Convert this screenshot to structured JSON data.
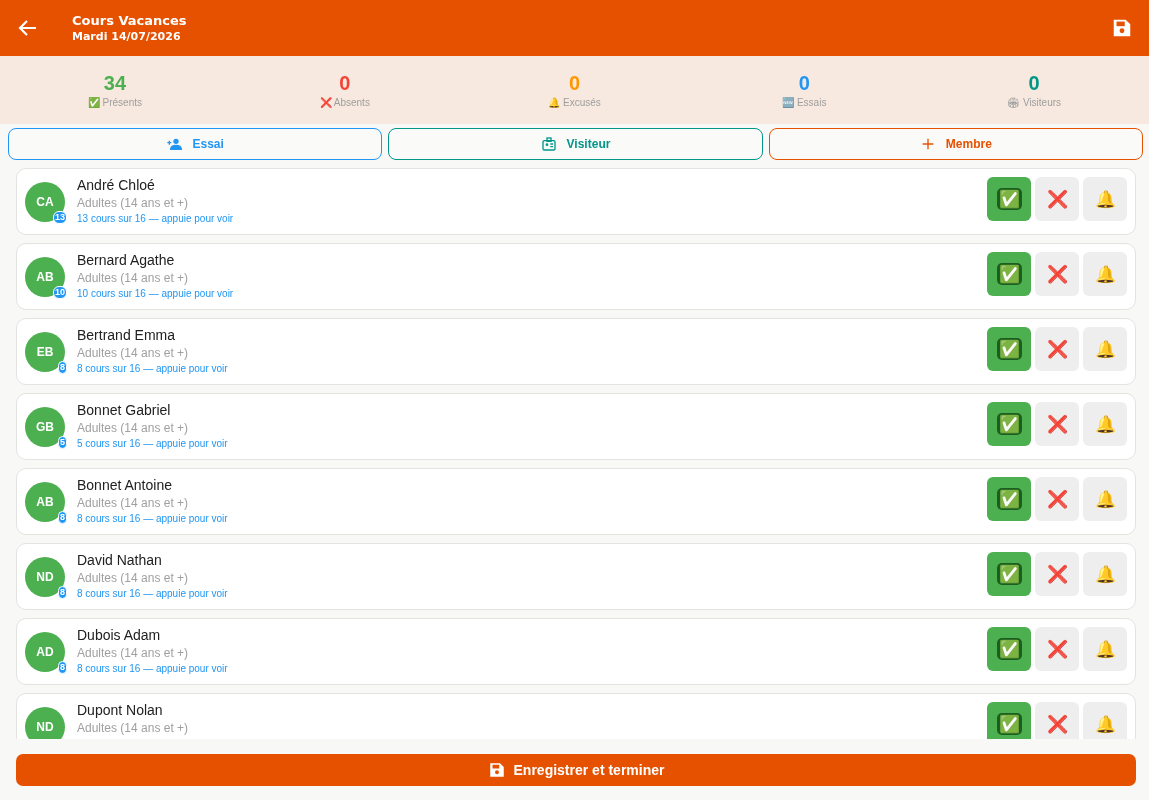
{
  "header": {
    "title": "Cours Vacances",
    "subtitle": "Mardi 14/07/2026"
  },
  "stats": [
    {
      "value": "34",
      "label": "✅ Présents",
      "color": "#4caf50"
    },
    {
      "value": "0",
      "label": "❌ Absents",
      "color": "#f44336"
    },
    {
      "value": "0",
      "label": "🔔 Excusés",
      "color": "#ff9800"
    },
    {
      "value": "0",
      "label": "🆕 Essais",
      "color": "#2196f3"
    },
    {
      "value": "0",
      "label": "🏟 Visiteurs",
      "color": "#009688"
    }
  ],
  "actions": [
    {
      "label": "Essai",
      "kind": "person-add",
      "color": "#2196f3"
    },
    {
      "label": "Visiteur",
      "kind": "badge",
      "color": "#009688"
    },
    {
      "label": "Membre",
      "kind": "plus",
      "color": "#e65100"
    }
  ],
  "members": [
    {
      "initials": "CA",
      "count": "13",
      "name": "André Chloé",
      "group": "Adultes (14 ans et +)",
      "progress": "13 cours sur 16 — appuie pour voir",
      "buttons": [
        {
          "label": "✅",
          "selected": true
        },
        {
          "label": "❌",
          "selected": false
        },
        {
          "label": "🔔",
          "selected": false
        }
      ]
    },
    {
      "initials": "AB",
      "count": "10",
      "name": "Bernard Agathe",
      "group": "Adultes (14 ans et +)",
      "progress": "10 cours sur 16 — appuie pour voir",
      "buttons": [
        {
          "label": "✅",
          "selected": true
        },
        {
          "label": "❌",
          "selected": false
        },
        {
          "label": "🔔",
          "selected": false
        }
      ]
    },
    {
      "initials": "EB",
      "count": "8",
      "name": "Bertrand Emma",
      "group": "Adultes (14 ans et +)",
      "progress": "8 cours sur 16 — appuie pour voir",
      "buttons": [
        {
          "label": "✅",
          "selected": true
        },
        {
          "label": "❌",
          "selected": false
        },
        {
          "label": "🔔",
          "selected": false
        }
      ]
    },
    {
      "initials": "GB",
      "count": "5",
      "name": "Bonnet Gabriel",
      "group": "Adultes (14 ans et +)",
      "progress": "5 cours sur 16 — appuie pour voir",
      "buttons": [
        {
          "label": "✅",
          "selected": true
        },
        {
          "label": "❌",
          "selected": false
        },
        {
          "label": "🔔",
          "selected": false
        }
      ]
    },
    {
      "initials": "AB",
      "count": "8",
      "name": "Bonnet Antoine",
      "group": "Adultes (14 ans et +)",
      "progress": "8 cours sur 16 — appuie pour voir",
      "buttons": [
        {
          "label": "✅",
          "selected": true
        },
        {
          "label": "❌",
          "selected": false
        },
        {
          "label": "🔔",
          "selected": false
        }
      ]
    },
    {
      "initials": "ND",
      "count": "8",
      "name": "David Nathan",
      "group": "Adultes (14 ans et +)",
      "progress": "8 cours sur 16 — appuie pour voir",
      "buttons": [
        {
          "label": "✅",
          "selected": true
        },
        {
          "label": "❌",
          "selected": false
        },
        {
          "label": "🔔",
          "selected": false
        }
      ]
    },
    {
      "initials": "AD",
      "count": "8",
      "name": "Dubois Adam",
      "group": "Adultes (14 ans et +)",
      "progress": "8 cours sur 16 — appuie pour voir",
      "buttons": [
        {
          "label": "✅",
          "selected": true
        },
        {
          "label": "❌",
          "selected": false
        },
        {
          "label": "🔔",
          "selected": false
        }
      ]
    },
    {
      "initials": "ND",
      "name": "Dupont Nolan",
      "group": "Adultes (14 ans et +)",
      "buttons": [
        {
          "label": "✅",
          "selected": true
        },
        {
          "label": "❌",
          "selected": false
        },
        {
          "label": "🔔",
          "selected": false
        }
      ]
    }
  ],
  "save_button": {
    "label": "Enregistrer et terminer"
  }
}
